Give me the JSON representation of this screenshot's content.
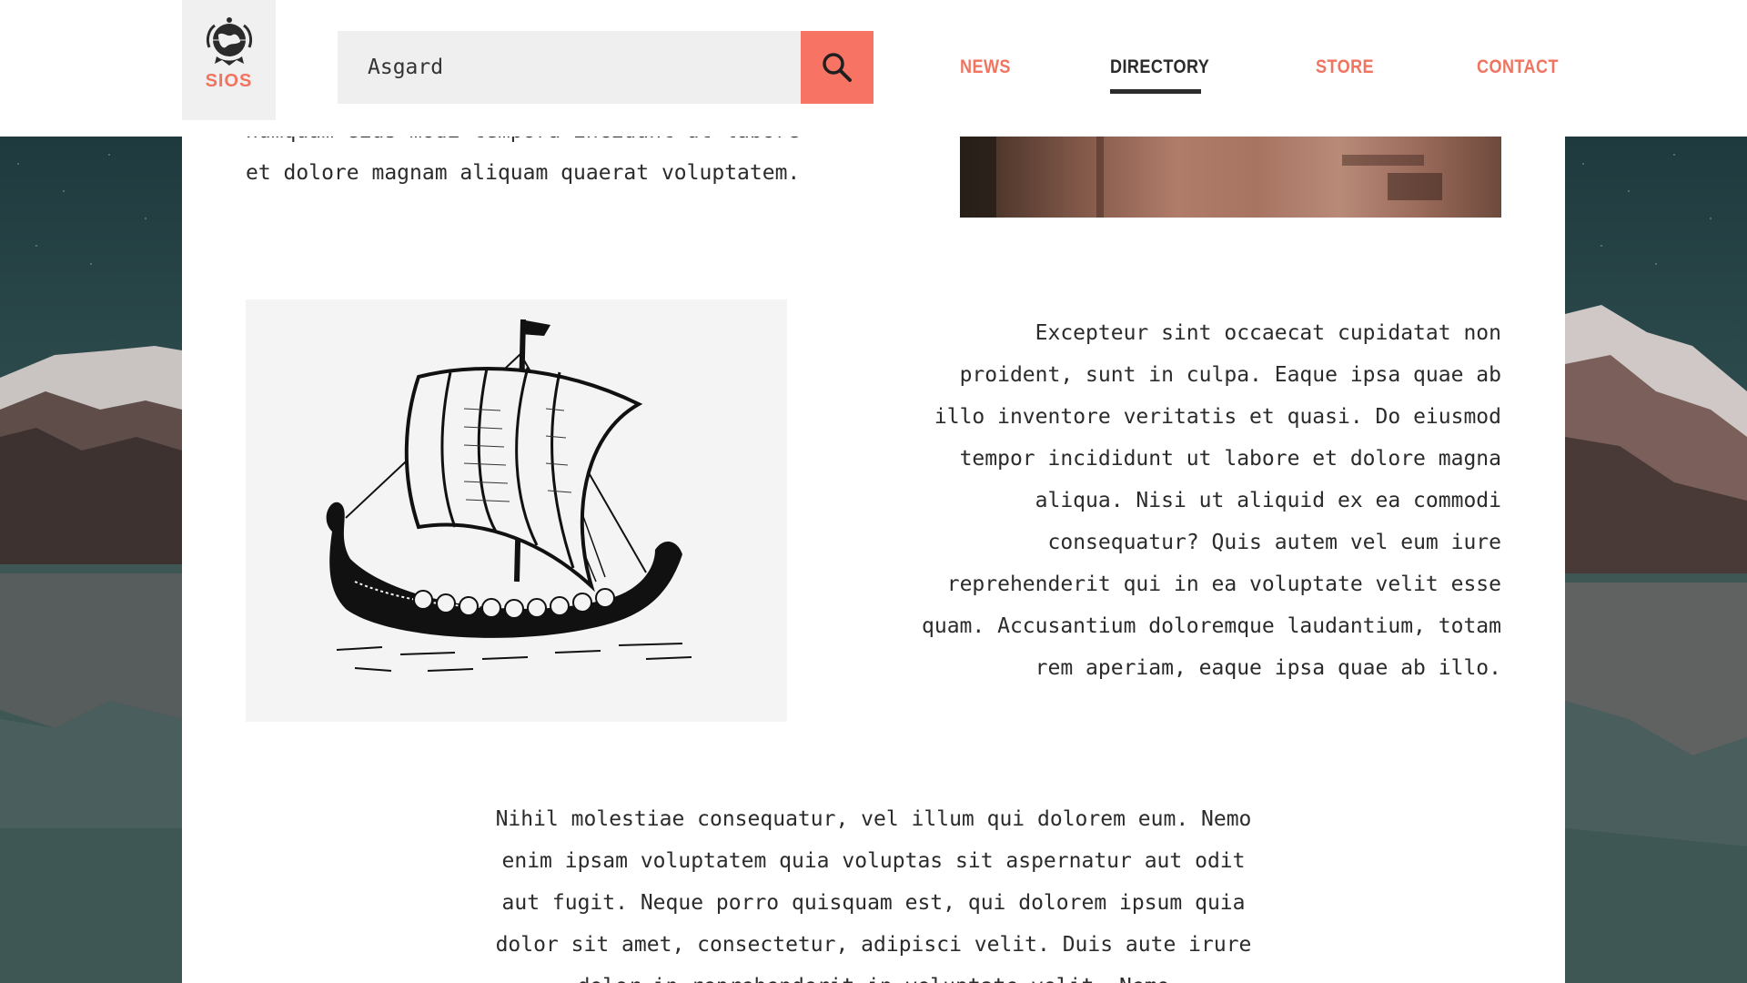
{
  "header": {
    "logo_text": "SIOS",
    "search": {
      "value": "Asgard",
      "placeholder": ""
    },
    "nav": [
      {
        "label": "NEWS",
        "active": false
      },
      {
        "label": "DIRECTORY",
        "active": true
      },
      {
        "label": "STORE",
        "active": false
      },
      {
        "label": "CONTACT",
        "active": false
      }
    ]
  },
  "main": {
    "intro_lines": [
      "numquam eius modi tempora incidunt ut labore",
      "et dolore magnam aliquam quaerat voluptatem."
    ],
    "right_paragraph_lines": [
      "Excepteur sint occaecat cupidatat non",
      "proident, sunt in culpa. Eaque ipsa quae ab",
      "illo inventore veritatis et quasi. Do eiusmod",
      "tempor incididunt ut labore et dolore magna",
      "aliqua. Nisi ut aliquid ex ea commodi",
      "consequatur? Quis autem vel eum iure",
      "reprehenderit qui in ea voluptate velit esse",
      "quam. Accusantium doloremque laudantium, totam",
      "rem aperiam, eaque ipsa quae ab illo."
    ],
    "bottom_paragraph_lines": [
      "Nihil molestiae consequatur, vel illum qui dolorem eum. Nemo",
      "enim ipsam voluptatem quia voluptas sit aspernatur aut odit",
      "aut fugit. Neque porro quisquam est, qui dolorem ipsum quia",
      "dolor sit amet, consectetur, adipisci velit. Duis aute irure",
      "dolor in reprehenderit in voluptate velit. Nemo"
    ]
  },
  "colors": {
    "accent": "#f77464",
    "text": "#2b2b2b",
    "search_bg": "#efefef",
    "logo_bg": "#f0f0f0"
  },
  "icons": {
    "search": "search-icon",
    "logo": "globe-emblem-icon"
  }
}
